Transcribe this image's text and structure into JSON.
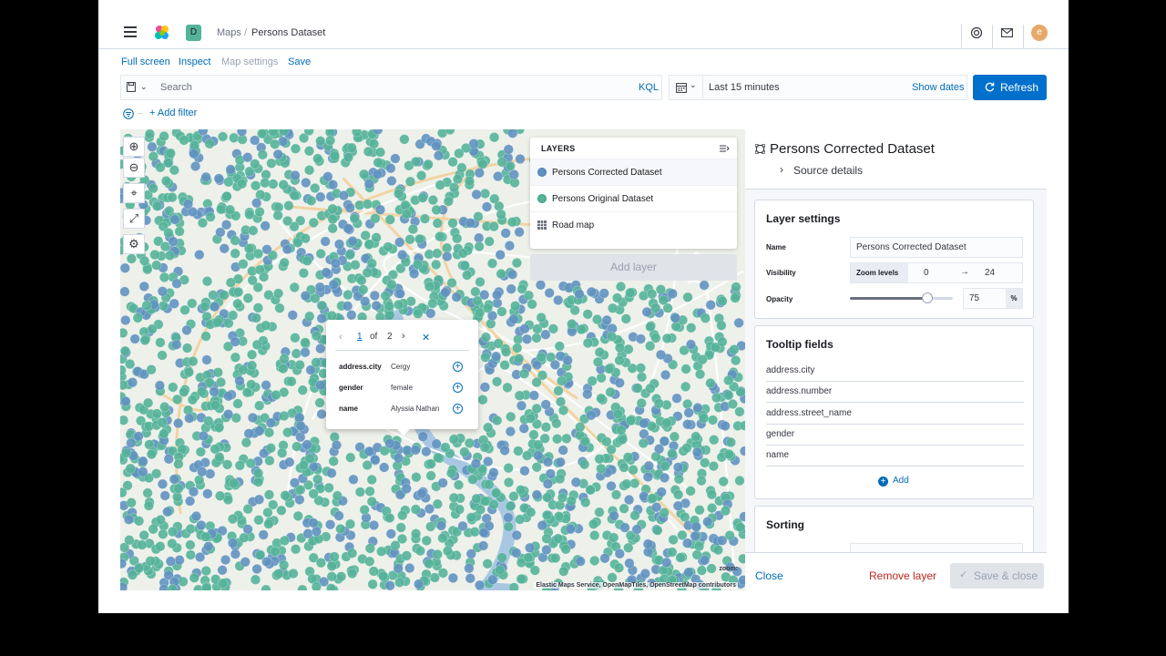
{
  "header": {
    "space_initial": "D",
    "breadcrumbs": [
      "Maps",
      "Persons Dataset"
    ],
    "breadcrumb_separator": "/",
    "avatar_initial": "e"
  },
  "top_menu": {
    "full_screen": "Full screen",
    "inspect": "Inspect",
    "map_settings": "Map settings",
    "save": "Save"
  },
  "query_bar": {
    "search_placeholder": "Search",
    "language": "KQL",
    "time_range": "Last 15 minutes",
    "show_dates": "Show dates",
    "refresh": "Refresh",
    "add_filter": "+ Add filter"
  },
  "map": {
    "colors": {
      "corrected": "#6092c0",
      "original": "#54b399"
    },
    "attribution": "Elastic Maps Service, OpenMapTiles, OpenStreetMap contributors",
    "zoom_label": "zoom:"
  },
  "layers_panel": {
    "title": "LAYERS",
    "layers": [
      {
        "name": "Persons Corrected Dataset",
        "swatch": "#6092c0",
        "icon": "circle-swatch-icon"
      },
      {
        "name": "Persons Original Dataset",
        "swatch": "#54b399",
        "icon": "circle-swatch-icon"
      },
      {
        "name": "Road map",
        "icon": "grid-icon"
      }
    ],
    "add_layer": "Add layer"
  },
  "tooltip": {
    "page": "1",
    "of": "of",
    "total": "2",
    "fields": [
      {
        "key": "address.city",
        "value": "Cergy"
      },
      {
        "key": "gender",
        "value": "female"
      },
      {
        "key": "name",
        "value": "Alyssia Nathan"
      }
    ]
  },
  "layer_editor": {
    "title": "Persons Corrected Dataset",
    "source_details": "Source details",
    "layer_settings": {
      "heading": "Layer settings",
      "name_label": "Name",
      "name_value": "Persons Corrected Dataset",
      "visibility_label": "Visibility",
      "zoom_levels_label": "Zoom levels",
      "zoom_min": "0",
      "zoom_max": "24",
      "opacity_label": "Opacity",
      "opacity_value": "75",
      "opacity_fraction": 0.75,
      "opacity_unit": "%"
    },
    "tooltip_fields": {
      "heading": "Tooltip fields",
      "fields": [
        "address.city",
        "address.number",
        "address.street_name",
        "gender",
        "name"
      ],
      "add": "Add"
    },
    "sorting": {
      "heading": "Sorting"
    },
    "footer": {
      "close": "Close",
      "remove_layer": "Remove layer",
      "save_close": "Save & close"
    }
  }
}
